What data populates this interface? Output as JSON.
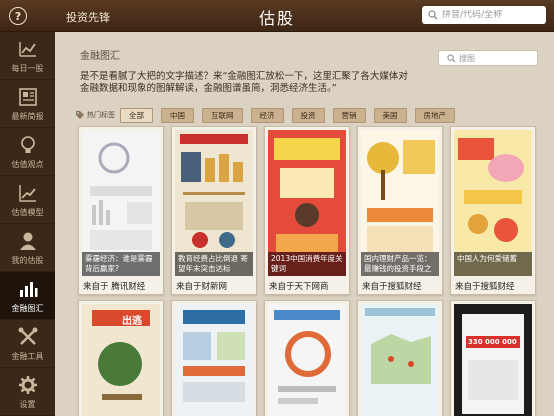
{
  "header": {
    "help_icon_glyph": "?",
    "nav_title": "投资先锋",
    "app_title": "估股",
    "search_placeholder": "拼音/代码/全称"
  },
  "sidebar": {
    "items": [
      {
        "label": "每日一股",
        "icon": "line-chart-icon"
      },
      {
        "label": "最新简报",
        "icon": "newspaper-icon"
      },
      {
        "label": "估值观点",
        "icon": "lightbulb-icon"
      },
      {
        "label": "估值模型",
        "icon": "trend-chart-icon"
      },
      {
        "label": "我的估股",
        "icon": "user-icon"
      },
      {
        "label": "金融图汇",
        "icon": "bar-chart-icon",
        "active": true
      },
      {
        "label": "金融工具",
        "icon": "tools-icon"
      },
      {
        "label": "设置",
        "icon": "gear-icon"
      }
    ]
  },
  "main": {
    "title": "金融图汇",
    "search_placeholder": "搜图",
    "description": "是不是看腻了大把的文字描述？来“金融图汇放松一下，这里汇聚了各大媒体对金融数据和现象的图解解读，金融图谱虽简，洞悉经济生活。”",
    "tags_label": "热门标签",
    "tags": [
      "全部",
      "中国",
      "互联网",
      "经济",
      "投资",
      "营销",
      "美国",
      "房地产"
    ],
    "cards": [
      {
        "overlay": "雾霾经济：谁是雾霾背后赢家?",
        "source": "来自于 腾讯财经"
      },
      {
        "overlay": "教育经费占比倒退 寄望年末突击达标",
        "source": "来自于财新网"
      },
      {
        "overlay": "2013中国消费年度关键词",
        "source": "来自于天下网商"
      },
      {
        "overlay": "国内理财产品一览：最赚钱的投资手段之一",
        "source": "来自于搜狐财经"
      },
      {
        "overlay": "中国人为何爱储蓄",
        "source": "来自于搜狐财经"
      }
    ],
    "second_row_texts": [
      "出逃",
      "330 000 000"
    ]
  },
  "colors": {
    "header": "#3d2614",
    "sidebar": "#3b2818",
    "tag": "#cbb28f",
    "background": "#dcd2c3"
  }
}
